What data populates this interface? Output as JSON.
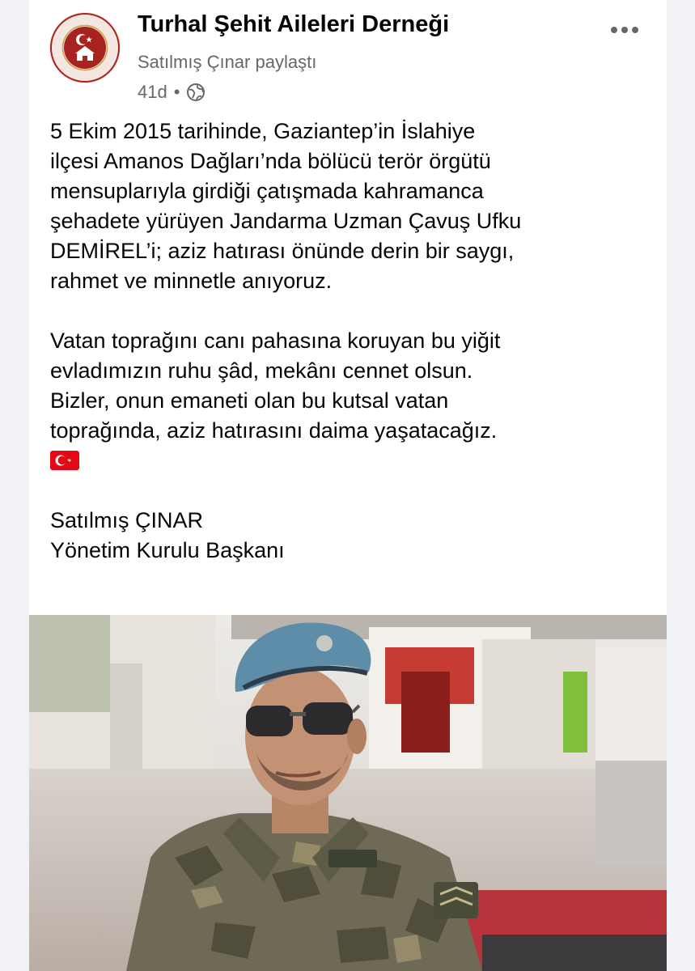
{
  "post": {
    "page_name": "Turhal Şehit Aileleri Derneği",
    "shared_by": "Satılmış Çınar paylaştı",
    "time": "41d",
    "separator": "•",
    "logo_text": "TURHAL ŞEHİT AİLELERİ DERNEĞİ",
    "paragraph1": [
      "5 Ekim 2015 tarihinde, Gaziantep’in İslahiye",
      "ilçesi Amanos Dağları’nda bölücü terör örgütü",
      "mensuplarıyla girdiği çatışmada kahramanca",
      "şehadete yürüyen Jandarma Uzman Çavuş Ufku",
      "DEMİREL’i; aziz hatırası önünde derin bir saygı,",
      "rahmet ve minnetle anıyoruz."
    ],
    "paragraph2": [
      "Vatan toprağını canı pahasına koruyan bu yiğit",
      "evladımızın ruhu şâd, mekânı cennet olsun.",
      "Bizler, onun emaneti olan bu kutsal vatan",
      "toprağında, aziz hatırasını daima yaşatacağız."
    ],
    "signature_name": "Satılmış ÇINAR",
    "signature_title": "Yönetim Kurulu Başkanı"
  },
  "icons": {
    "more": "more-horizontal-icon",
    "audience": "globe-icon",
    "flag": "turkish-flag-emoji"
  },
  "colors": {
    "text": "#050505",
    "secondary": "#65676b",
    "logo_red": "#a8231f",
    "flag_red": "#e30a17"
  }
}
